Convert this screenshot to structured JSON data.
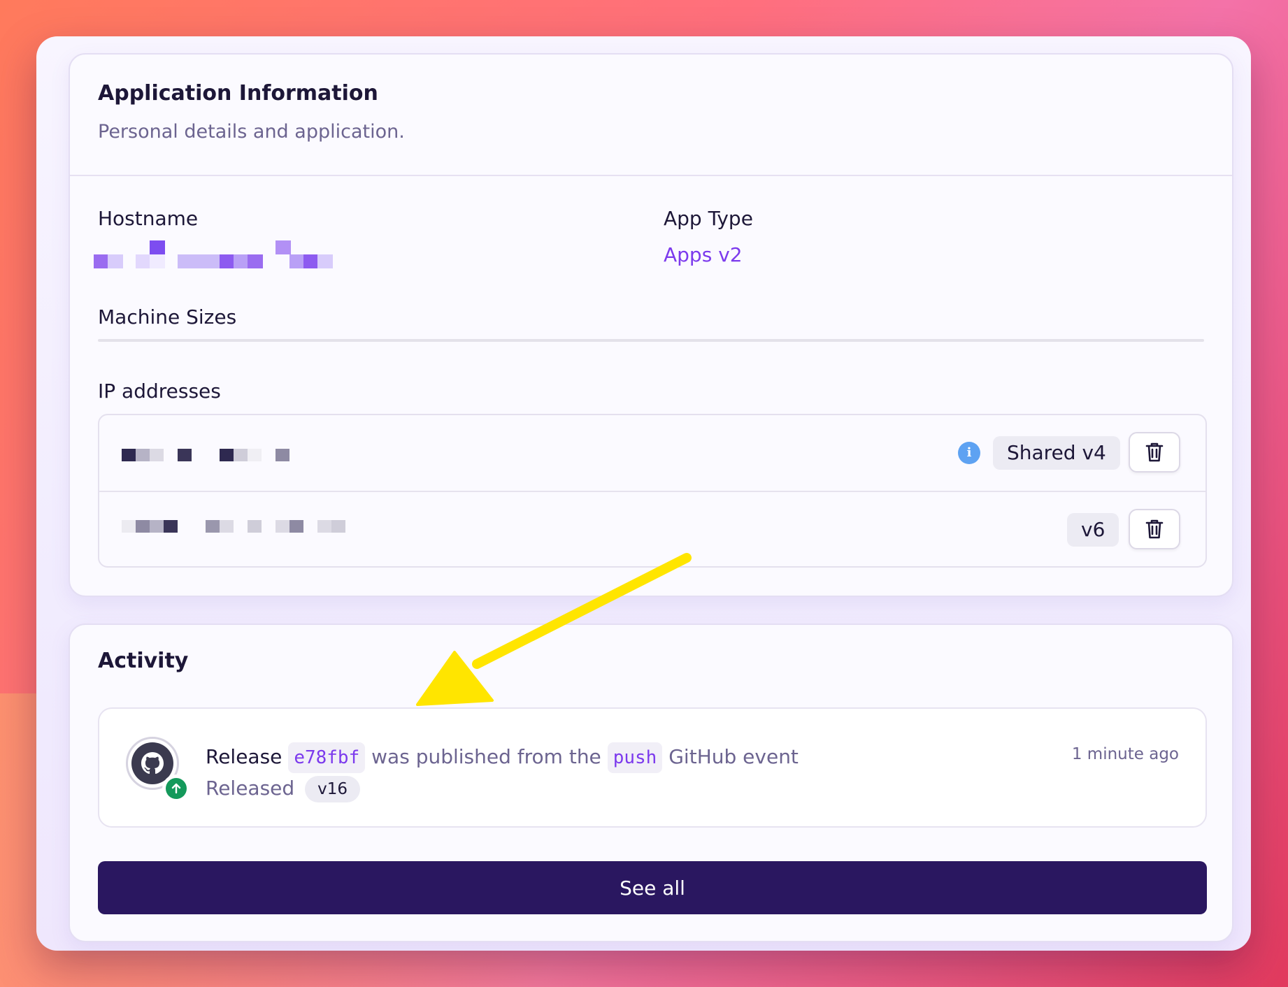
{
  "app_info": {
    "title": "Application Information",
    "subtitle": "Personal details and application.",
    "hostname_label": "Hostname",
    "app_type_label": "App Type",
    "app_type_value": "Apps v2",
    "machine_sizes_label": "Machine Sizes",
    "ip_label": "IP addresses",
    "ip_rows": [
      {
        "badge": "Shared v4",
        "has_info_icon": true
      },
      {
        "badge": "v6",
        "has_info_icon": false
      }
    ]
  },
  "activity": {
    "title": "Activity",
    "item": {
      "release_word": "Release",
      "commit": "e78fbf",
      "middle_text": "was published from the",
      "event": "push",
      "tail_text": "GitHub event",
      "status_text": "Released",
      "version": "v16",
      "time": "1 minute ago"
    },
    "see_all_label": "See all"
  },
  "icons": {
    "info": "info-icon",
    "trash": "trash-icon",
    "github": "github-icon",
    "status": "arrow-up-circle-icon"
  },
  "colors": {
    "accent": "#7c3aed",
    "button_bg": "#2a1760",
    "annotation_arrow": "#ffe500",
    "info_blue": "#5ea2f2",
    "status_green": "#14995b"
  }
}
